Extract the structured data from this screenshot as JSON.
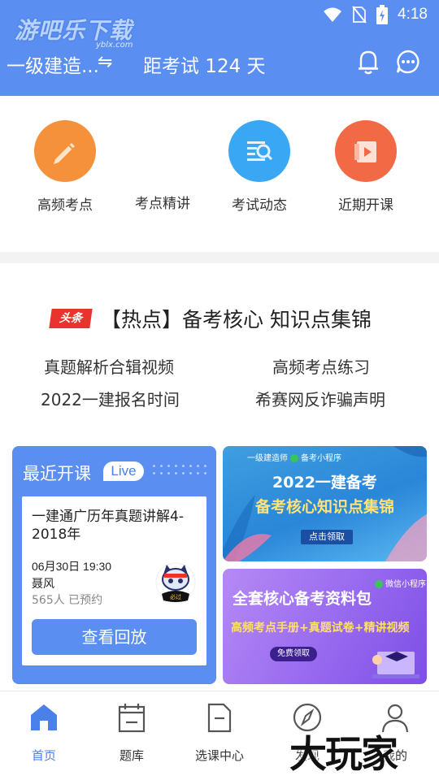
{
  "status_bar": {
    "time": "4:18"
  },
  "watermark_top": {
    "text": "游吧乐下载",
    "sub": "yblx.com"
  },
  "header": {
    "exam_select": "一级建造...",
    "swap_symbol": "⇋",
    "countdown": "距考试 124 天"
  },
  "quick_entries": [
    {
      "label": "高频考点",
      "icon": "pencil-icon",
      "color": "#f5913a"
    },
    {
      "label": "考点精讲",
      "icon": ""
    },
    {
      "label": "考试动态",
      "icon": "search-doc-icon",
      "color": "#3aa7f5"
    },
    {
      "label": "近期开课",
      "icon": "video-icon",
      "color": "#f26a45"
    }
  ],
  "headline": {
    "badge": "头条",
    "text": "【热点】备考核心 知识点集锦"
  },
  "links": [
    "真题解析合辑视频",
    "高频考点练习",
    "2022一建报名时间",
    "希赛网反诈骗声明"
  ],
  "recent_course": {
    "title": "最近开课",
    "live_badge": "Live",
    "course_name": "一建通广历年真题讲解4-2018年",
    "time": "06月30日 19:30",
    "teacher": "聂风",
    "count": "565人 已预约",
    "avatar_tag": "必过",
    "button": "查看回放"
  },
  "banner1": {
    "tag": "一级建造师",
    "mini": "备考小程序",
    "title": "2022一建备考",
    "subtitle": "备考核心知识点集锦",
    "button": "点击领取"
  },
  "banner2": {
    "mini": "微信小程序",
    "title": "全套核心备考资料包",
    "subtitle": "高频考点手册+真题试卷+精讲视频",
    "button": "免费领取"
  },
  "bottom_nav": [
    {
      "label": "首页",
      "icon": "home-icon",
      "active": true
    },
    {
      "label": "题库",
      "icon": "calendar-icon",
      "active": false
    },
    {
      "label": "选课中心",
      "icon": "document-icon",
      "active": false
    },
    {
      "label": "发现",
      "icon": "compass-icon",
      "active": false
    },
    {
      "label": "我的",
      "icon": "user-icon",
      "active": false
    }
  ],
  "watermark_bottom": "大玩家",
  "colors": {
    "primary": "#5a8ef0",
    "active_tab": "#4a80ea",
    "badge_red": "#e8342c"
  }
}
